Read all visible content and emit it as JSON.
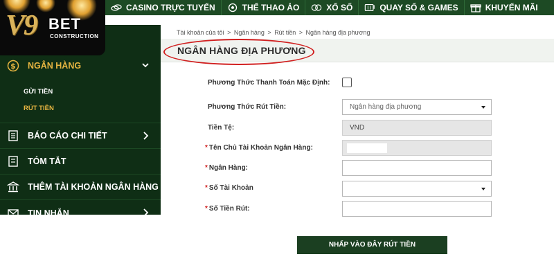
{
  "logo": {
    "brand_v9": "V9",
    "brand_bet": "BET",
    "brand_sub": "CONSTRUCTION"
  },
  "topnav": {
    "items": [
      {
        "label": "CASINO TRỰC TUYẾN",
        "icon": "chips-icon"
      },
      {
        "label": "THỂ THAO ẢO",
        "icon": "soccer-ball-icon"
      },
      {
        "label": "XỔ SỐ",
        "icon": "lottery-icon"
      },
      {
        "label": "QUAY SỐ & GAMES",
        "icon": "slot-machine-icon"
      },
      {
        "label": "KHUYẾN MÃI",
        "icon": "gift-icon"
      }
    ]
  },
  "sidebar": {
    "active": {
      "label": "NGÂN HÀNG",
      "icon": "dollar-coin-icon"
    },
    "submenu": [
      {
        "label": "GỬI TIỀN"
      },
      {
        "label": "RÚT TIỀN"
      }
    ],
    "items": [
      {
        "label": "BÁO CÁO CHI TIẾT",
        "icon": "report-icon"
      },
      {
        "label": "TÓM TẮT",
        "icon": "summary-icon"
      },
      {
        "label": "THÊM TÀI KHOẢN NGÂN HÀNG",
        "icon": "bank-icon"
      },
      {
        "label": "TIN NHẮN",
        "icon": "envelope-icon"
      }
    ]
  },
  "breadcrumb": {
    "items": [
      "Tài khoản của tôi",
      "Ngân hàng",
      "Rút tiền",
      "Ngân hàng địa phương"
    ],
    "separator": ">"
  },
  "page": {
    "title": "NGÂN HÀNG ĐỊA PHƯƠNG"
  },
  "form": {
    "default_payment_label": "Phương Thức Thanh Toán Mặc Định:",
    "withdraw_method_label": "Phương Thức Rút Tiền:",
    "withdraw_method_value": "Ngân hàng địa phương",
    "currency_label": "Tiền Tệ:",
    "currency_value": "VND",
    "account_holder_label": "Tên Chủ Tài Khoản Ngân Hàng:",
    "bank_label": "Ngân Hàng:",
    "account_number_label": "Số Tài Khoản",
    "amount_label": "Số Tiền Rút:",
    "required_mark": "*",
    "submit_label": "NHẤP VÀO ĐÂY RÚT TIỀN"
  },
  "colors": {
    "nav_green": "#1d4a24",
    "sidebar_green": "#0f2e15",
    "accent_gold": "#e7b541",
    "button_green": "#1b3f21",
    "highlight_red": "#d12020"
  }
}
